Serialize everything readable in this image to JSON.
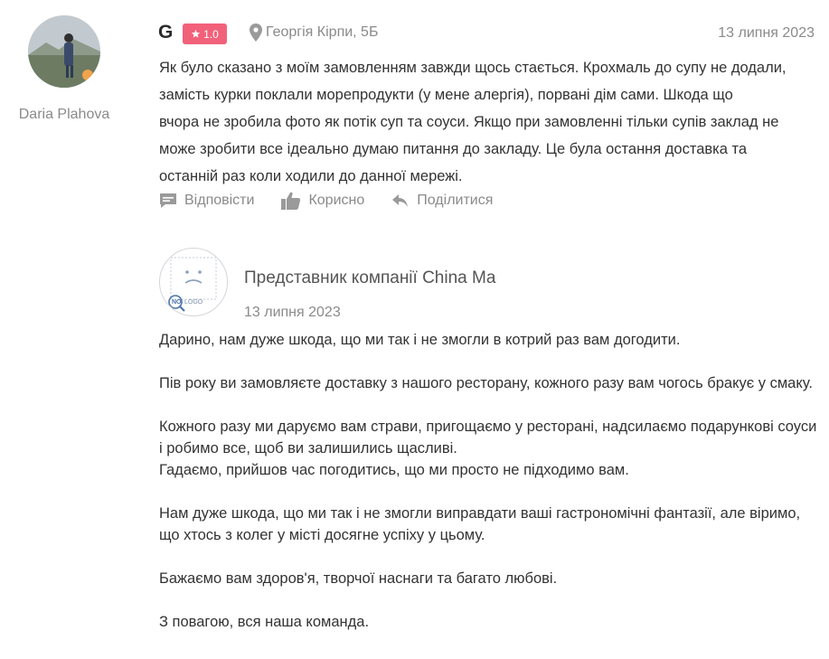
{
  "review": {
    "reviewer_name": "Daria Plahova",
    "source_letter": "G",
    "rating": "1.0",
    "location": "Георгія Кірпи, 5Б",
    "date": "13 липня 2023",
    "text_lines": [
      "Як було сказано з моїм замовленням завжди щось стається. Крохмаль до супу не додали,",
      "замість курки поклали морепродукти (у мене алергія), порвані дім сами. Шкода що",
      "вчора не зробила фото як потік суп та соуси. Якщо при замовленні тільки супів заклад не",
      "може зробити все ідеально думаю питання до закладу. Це була остання доставка та",
      "останній раз коли ходили до данної мережі."
    ],
    "actions": {
      "reply": "Відповісти",
      "useful": "Корисно",
      "share": "Поділитися"
    }
  },
  "reply": {
    "company_name": "Представник компанії China Ma",
    "logo_text": "NO LOGO",
    "date": "13 липня 2023",
    "paragraphs": [
      " Дарино, нам дуже шкода, що ми так і не змогли в котрий раз вам догодити.",
      "Пів року ви замовляєте доставку з нашого ресторану, кожного разу вам чогось бракує у смаку.",
      "Кожного разу ми даруємо вам страви, пригощаємо у ресторані, надсилаємо подарункові соуси і робимо все, щоб ви залишились щасливі.",
      "Гадаємо, прийшов час погодитись, що ми просто не підходимо вам.",
      "Нам дуже шкода, що ми так і не змогли виправдати ваші гастрономічні фантазії, але віримо, що хтось з колег у місті досягне успіху у цьому.",
      "Бажаємо вам здоров'я, творчої наснаги та багато любові.",
      "З повагою, вся наша команда."
    ]
  },
  "colors": {
    "rating_badge": "#f2617a",
    "muted_text": "#8a8a8a",
    "body_text": "#333333"
  },
  "icons": {
    "rating": "star-icon",
    "location": "map-pin-icon",
    "reply": "speech-bubble-icon",
    "useful": "thumbs-up-icon",
    "share": "share-arrow-icon"
  }
}
